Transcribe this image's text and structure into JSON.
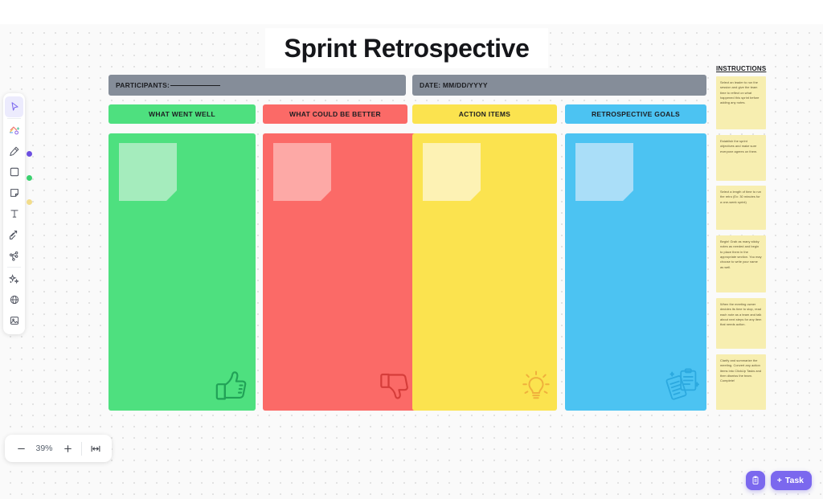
{
  "board": {
    "title": "Sprint Retrospective",
    "header_fields": [
      {
        "id": "participants",
        "label": "PARTICIPANTS:",
        "has_blank_line": true
      },
      {
        "id": "date",
        "label": "DATE: MM/DD/YYYY",
        "has_blank_line": false
      }
    ],
    "columns": [
      {
        "id": "what-went-well",
        "label": "WHAT WENT WELL",
        "color": "#4ee07f",
        "chip_color": "#4ee07f",
        "note_color": "#a5ecbd",
        "icon": "thumbs-up-icon",
        "icon_color": "#1f9e55"
      },
      {
        "id": "what-could-be-better",
        "label": "WHAT COULD BE BETTER",
        "color": "#fb6a67",
        "chip_color": "#fb6a67",
        "note_color": "#fda9a6",
        "icon": "thumbs-down-icon",
        "icon_color": "#d43b38"
      },
      {
        "id": "action-items",
        "label": "ACTION ITEMS",
        "color": "#fbe34f",
        "chip_color": "#fbe34f",
        "note_color": "#fdf2b4",
        "icon": "lightbulb-icon",
        "icon_color": "#efae3c"
      },
      {
        "id": "retrospective-goals",
        "label": "RETROSPECTIVE GOALS",
        "color": "#4cc3f2",
        "chip_color": "#4cc3f2",
        "note_color": "#aadef8",
        "icon": "clipboard-notes-icon",
        "icon_color": "#2ba8df"
      }
    ],
    "instructions": {
      "title": "INSTRUCTIONS",
      "notes": [
        "Select an leader to run the session and give the team time to reflect on what happened this sprint before adding any notes.",
        "Establish the sprint objectives and make sure everyone agrees on them.",
        "Select a length of time to run the retro (Ex: 30 minutes for a one-week sprint)",
        "Begin! Grab as many sticky notes as needed and begin to place them in the appropriate section. You may choose to write your name as well.",
        "When the meeting owner decides its time to stop, read each note as a team and talk about next steps for any item that needs action.",
        "Clarify and summarize the meeting. Convert any action items into ClickUp Tasks and then dismiss the team. Complete!"
      ]
    }
  },
  "toolbar": {
    "items": [
      {
        "id": "select",
        "icon": "cursor-select-icon",
        "active": true
      },
      {
        "id": "shapes",
        "icon": "shapes-add-icon",
        "active": false
      },
      {
        "id": "pen",
        "icon": "pen-marker-icon",
        "active": false
      },
      {
        "id": "rectangle",
        "icon": "rectangle-icon",
        "active": false
      },
      {
        "id": "sticky",
        "icon": "sticky-note-icon",
        "active": false
      },
      {
        "id": "text",
        "icon": "text-icon",
        "active": false
      },
      {
        "id": "connector",
        "icon": "connector-arrow-icon",
        "active": false
      },
      {
        "id": "mindmap",
        "icon": "mindmap-icon",
        "active": false
      },
      {
        "id": "ai",
        "icon": "ai-sparkle-icon",
        "active": false
      },
      {
        "id": "web",
        "icon": "globe-icon",
        "active": false
      },
      {
        "id": "image",
        "icon": "image-icon",
        "active": false
      }
    ],
    "swatches": [
      "#6c4fe0",
      "#3bd16f",
      "#f2dc8a"
    ]
  },
  "zoom_controls": {
    "zoom_out_label": "−",
    "level": "39%",
    "zoom_in_label": "+",
    "fit_label": "fit-to-screen-icon"
  },
  "bottom_actions": {
    "doc_button": "clipboard-icon",
    "task_button_label": "Task",
    "task_button_plus": "+",
    "accent": "#7b68ee"
  }
}
